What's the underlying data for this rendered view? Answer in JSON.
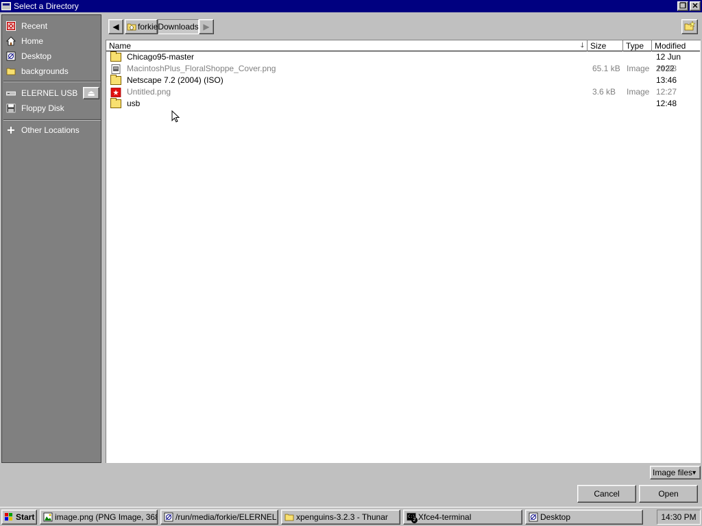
{
  "window": {
    "title": "Select a Directory",
    "restore_glyph": "❐",
    "close_glyph": "✕"
  },
  "sidebar": {
    "items": [
      {
        "label": "Recent",
        "icon": "recent-icon"
      },
      {
        "label": "Home",
        "icon": "home-icon"
      },
      {
        "label": "Desktop",
        "icon": "desktop-icon"
      },
      {
        "label": "backgrounds",
        "icon": "folder-icon"
      },
      {
        "label": "ELERNEL USB",
        "icon": "usb-drive-icon"
      },
      {
        "label": "Floppy Disk",
        "icon": "floppy-icon"
      },
      {
        "label": "Other Locations",
        "icon": "plus-icon"
      }
    ],
    "eject_glyph": "⏏"
  },
  "pathbar": {
    "back_glyph": "◀",
    "forward_glyph": "▶",
    "crumbs": [
      "forkie",
      "Downloads"
    ],
    "new_folder_icon": "new-folder-icon"
  },
  "columns": {
    "name": "Name",
    "size": "Size",
    "type": "Type",
    "modified": "Modified",
    "sort_glyph": "🡓"
  },
  "files": [
    {
      "name": "Chicago95-master",
      "size": "",
      "type": "",
      "modified": "12 Jun 2022",
      "kind": "folder",
      "dim": false
    },
    {
      "name": "MacintoshPlus_FloralShoppe_Cover.png",
      "size": "65.1 kB",
      "type": "Image",
      "modified": "14:28",
      "kind": "image",
      "dim": true
    },
    {
      "name": "Netscape 7.2 (2004) (ISO)",
      "size": "",
      "type": "",
      "modified": "13:46",
      "kind": "folder",
      "dim": false
    },
    {
      "name": "Untitled.png",
      "size": "3.6 kB",
      "type": "Image",
      "modified": "12:27",
      "kind": "image-red",
      "dim": true
    },
    {
      "name": "usb",
      "size": "",
      "type": "",
      "modified": "12:48",
      "kind": "folder",
      "dim": false
    }
  ],
  "filter": {
    "value": "Image files",
    "arrow": "▼"
  },
  "buttons": {
    "cancel": "Cancel",
    "open": "Open"
  },
  "taskbar": {
    "start": "Start",
    "tasks": [
      "image.png (PNG Image, 368...",
      "/run/media/forkie/ELERNEL ...",
      "xpenguins-3.2.3 - Thunar",
      "Xfce4-terminal",
      "Desktop"
    ],
    "terminal_badge": "2",
    "clock": "14:30 PM"
  },
  "colors": {
    "titlebar": "#000080",
    "sidebar": "#808080",
    "face": "#c0c0c0",
    "folder": "#f8e070"
  }
}
